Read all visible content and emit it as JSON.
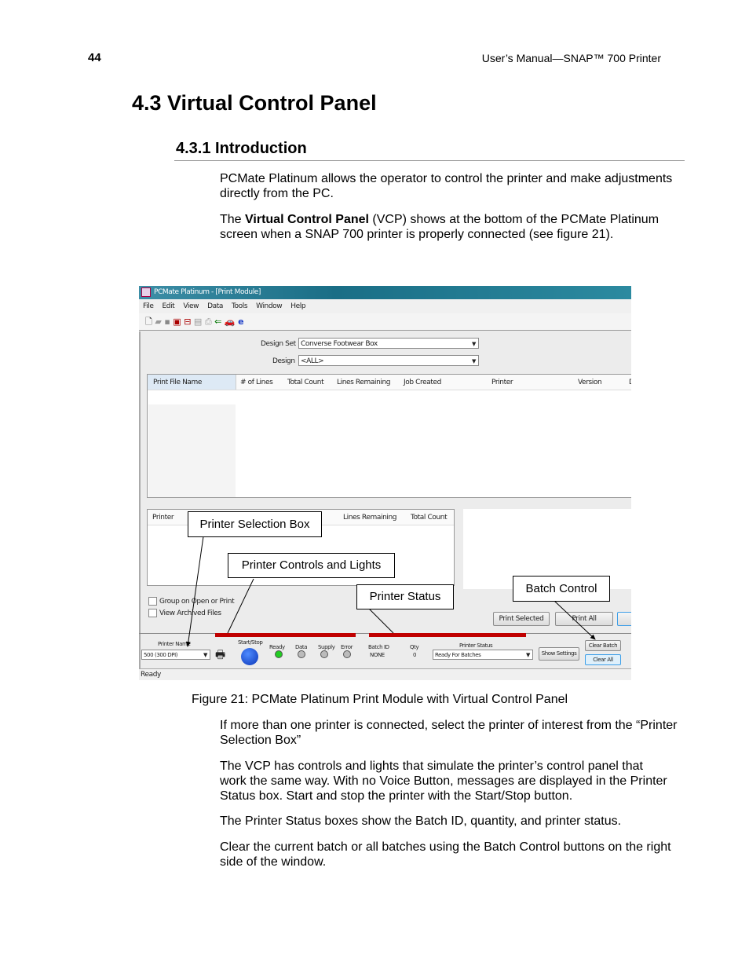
{
  "header": {
    "page_number": "44",
    "running_title": "User’s Manual—SNAP™ 700 Printer"
  },
  "section_title": "4.3 Virtual Control Panel",
  "subsection_title": "4.3.1 Introduction",
  "intro": {
    "p1": "PCMate Platinum allows the operator to control the printer and make adjustments directly from the PC.",
    "p2_pre": "The ",
    "p2_bold": "Virtual Control Panel",
    "p2_post": " (VCP) shows at the bottom of the PCMate Platinum screen when a SNAP 700 printer is properly connected (see figure 21)."
  },
  "screenshot": {
    "title": "PCMate Platinum - [Print Module]",
    "menu": [
      "File",
      "Edit",
      "View",
      "Data",
      "Tools",
      "Window",
      "Help"
    ],
    "design_set_label": "Design Set",
    "design_set_value": "Converse Footwear Box",
    "design_label": "Design",
    "design_value": "<ALL>",
    "columns": [
      "Print File Name",
      "# of Lines",
      "Total Count",
      "Lines Remaining",
      "Job Created",
      "Printer",
      "Version",
      "D"
    ],
    "printer_columns": [
      "Printer",
      "Lines Remaining",
      "Total Count"
    ],
    "checkboxes": [
      "Group on Open or Print",
      "View Archived Files"
    ],
    "print_selected": "Print Selected",
    "print_all": "Print All",
    "vcp": {
      "printer_name_label": "Printer Name",
      "printer_name_value": "500 (300 DPI)",
      "start_stop": "Start/Stop",
      "lights": [
        {
          "label": "Ready",
          "color": "#22cc22"
        },
        {
          "label": "Data",
          "color": "#bbbbbb"
        },
        {
          "label": "Supply",
          "color": "#bbbbbb"
        },
        {
          "label": "Error",
          "color": "#bbbbbb"
        }
      ],
      "batch_id_label": "Batch ID",
      "batch_id_value": "NONE",
      "qty_label": "Qty",
      "qty_value": "0",
      "printer_status_label": "Printer Status",
      "printer_status_value": "Ready For Batches",
      "show_settings": "Show Settings",
      "clear_batch": "Clear Batch",
      "clear_all": "Clear All"
    },
    "status_bar": "Ready",
    "callouts": {
      "selection": "Printer Selection Box",
      "controls": "Printer Controls and Lights",
      "status": "Printer Status",
      "batch": "Batch Control"
    }
  },
  "caption": "Figure 21:  PCMate Platinum Print Module with Virtual Control Panel",
  "paragraphs": [
    "If more than one printer is connected, select the printer of interest from the “Printer Selection Box”",
    "The VCP has controls and lights that simulate the printer’s control panel that work the same way.  With no Voice Button, messages are displayed in the Printer Status box. Start and stop the printer with the Start/Stop button.",
    "The Printer Status boxes show the Batch ID, quantity, and printer status.",
    "Clear the current batch or all batches using the Batch Control buttons on the right side of the window."
  ]
}
